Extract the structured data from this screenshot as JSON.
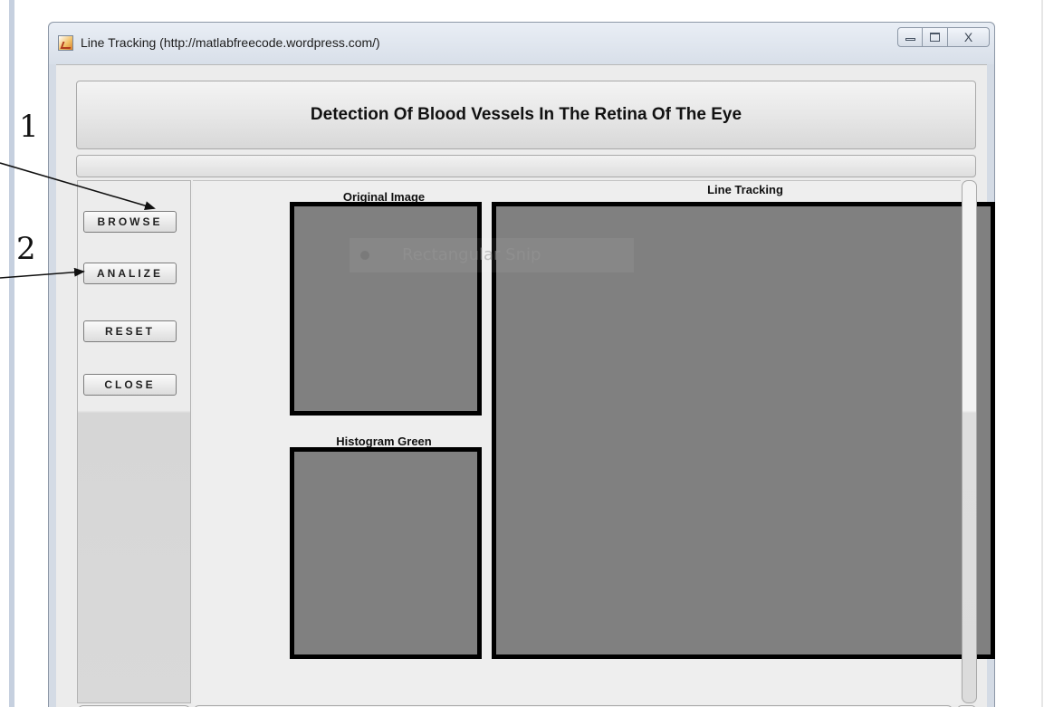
{
  "window": {
    "title": "Line Tracking (http://matlabfreecode.wordpress.com/)",
    "close_glyph": "X"
  },
  "header": {
    "title": "Detection Of Blood Vessels In The Retina Of The Eye"
  },
  "sidebar": {
    "buttons": [
      {
        "label": "BROWSE"
      },
      {
        "label": "ANALIZE"
      },
      {
        "label": "RESET"
      },
      {
        "label": "CLOSE"
      }
    ]
  },
  "axes": {
    "original": "Original Image",
    "histogram": "Histogram Green",
    "line_tracking": "Line Tracking"
  },
  "overlay": {
    "snip_text": "Rectangular Snip"
  },
  "annotations": [
    {
      "number": "1"
    },
    {
      "number": "2"
    }
  ]
}
